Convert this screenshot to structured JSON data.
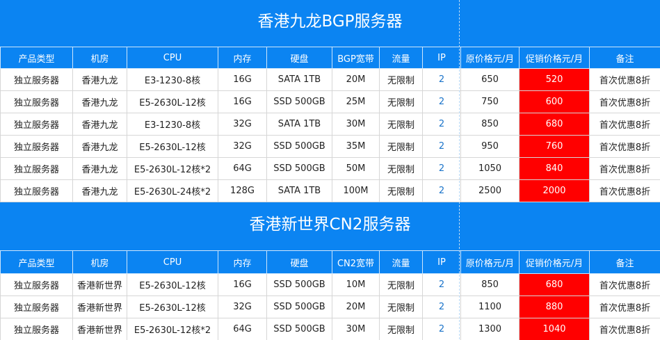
{
  "columns": [
    "产品类型",
    "机房",
    "CPU",
    "内存",
    "硬盘",
    "",
    "流量",
    "IP",
    "原价格元/月",
    "促销价格元/月",
    "备注"
  ],
  "sections": [
    {
      "title": "香港九龙BGP服务器",
      "bandwidth_header": "BGP宽带",
      "rows": [
        [
          "独立服务器",
          "香港九龙",
          "E3-1230-8核",
          "16G",
          "SATA 1TB",
          "20M",
          "无限制",
          "2",
          "650",
          "520",
          "首次优惠8折"
        ],
        [
          "独立服务器",
          "香港九龙",
          "E5-2630L-12核",
          "16G",
          "SSD 500GB",
          "25M",
          "无限制",
          "2",
          "750",
          "600",
          "首次优惠8折"
        ],
        [
          "独立服务器",
          "香港九龙",
          "E3-1230-8核",
          "32G",
          "SATA 1TB",
          "30M",
          "无限制",
          "2",
          "850",
          "680",
          "首次优惠8折"
        ],
        [
          "独立服务器",
          "香港九龙",
          "E5-2630L-12核",
          "32G",
          "SSD 500GB",
          "35M",
          "无限制",
          "2",
          "950",
          "760",
          "首次优惠8折"
        ],
        [
          "独立服务器",
          "香港九龙",
          "E5-2630L-12核*2",
          "64G",
          "SSD 500GB",
          "50M",
          "无限制",
          "2",
          "1050",
          "840",
          "首次优惠8折"
        ],
        [
          "独立服务器",
          "香港九龙",
          "E5-2630L-24核*2",
          "128G",
          "SATA 1TB",
          "100M",
          "无限制",
          "2",
          "2500",
          "2000",
          "首次优惠8折"
        ]
      ]
    },
    {
      "title": "香港新世界CN2服务器",
      "bandwidth_header": "CN2宽带",
      "rows": [
        [
          "独立服务器",
          "香港新世界",
          "E5-2630L-12核",
          "16G",
          "SSD 500GB",
          "10M",
          "无限制",
          "2",
          "850",
          "680",
          "首次优惠8折"
        ],
        [
          "独立服务器",
          "香港新世界",
          "E5-2630L-12核",
          "32G",
          "SSD 500GB",
          "20M",
          "无限制",
          "2",
          "1100",
          "880",
          "首次优惠8折"
        ],
        [
          "独立服务器",
          "香港新世界",
          "E5-2630L-12核*2",
          "64G",
          "SSD 500GB",
          "30M",
          "无限制",
          "2",
          "1300",
          "1040",
          "首次优惠8折"
        ]
      ]
    }
  ],
  "colors": {
    "header_blue": "#0b84f2",
    "promo_red": "#ff0000",
    "ip_blue": "#1a73c9"
  }
}
